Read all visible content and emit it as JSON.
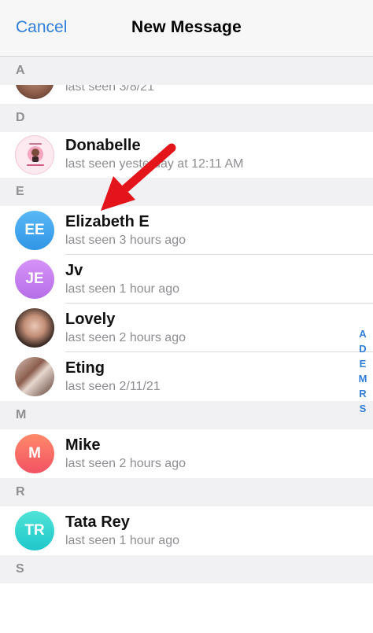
{
  "nav": {
    "cancel_label": "Cancel",
    "title": "New Message"
  },
  "sections": {
    "a": "A",
    "d": "D",
    "e": "E",
    "m": "M",
    "r": "R",
    "s": "S"
  },
  "contacts": [
    {
      "name": "",
      "status": "last seen 3/8/21",
      "avatar_type": "photo"
    },
    {
      "name": "Donabelle",
      "status": "last seen yesterday at 12:11 AM",
      "avatar_type": "photo"
    },
    {
      "name": "Elizabeth E",
      "status": "last seen 3 hours ago",
      "initials": "EE",
      "color": "#3ba7ee"
    },
    {
      "name": "Jv",
      "status": "last seen 1 hour ago",
      "initials": "JE",
      "color": "#c27af0"
    },
    {
      "name": "Lovely",
      "status": "last seen 2 hours ago",
      "avatar_type": "photo"
    },
    {
      "name": "Eting",
      "status": "last seen 2/11/21",
      "avatar_type": "photo"
    },
    {
      "name": "Mike",
      "status": "last seen 2 hours ago",
      "initials": "M",
      "color": "#f96a5f"
    },
    {
      "name": "Tata Rey",
      "status": "last seen 1 hour ago",
      "initials": "TR",
      "color": "#2fd5cf"
    }
  ],
  "index_letters": [
    "A",
    "D",
    "E",
    "M",
    "R",
    "S"
  ],
  "colors": {
    "accent": "#2f7fd9",
    "arrow": "#e4141b"
  }
}
